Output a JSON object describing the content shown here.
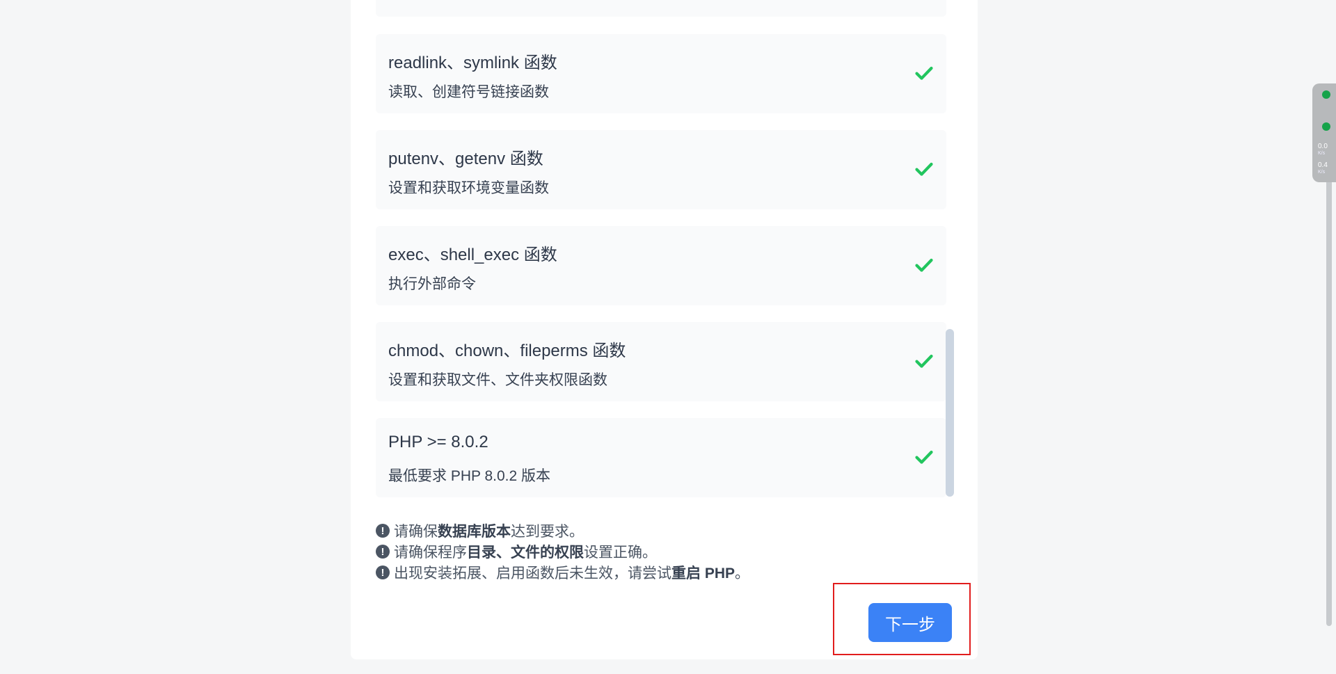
{
  "items": [
    {
      "title": "readlink、symlink 函数",
      "desc": "读取、创建符号链接函数",
      "status": "ok"
    },
    {
      "title": "putenv、getenv 函数",
      "desc": "设置和获取环境变量函数",
      "status": "ok"
    },
    {
      "title": "exec、shell_exec 函数",
      "desc": "执行外部命令",
      "status": "ok"
    },
    {
      "title": "chmod、chown、fileperms 函数",
      "desc": "设置和获取文件、文件夹权限函数",
      "status": "ok"
    },
    {
      "title": "PHP >= 8.0.2",
      "desc": "最低要求 PHP 8.0.2 版本",
      "status": "ok"
    }
  ],
  "notes": [
    {
      "pre": "请确保",
      "bold": "数据库版本",
      "post": "达到要求。"
    },
    {
      "pre": "请确保程序",
      "bold": "目录、文件的权限",
      "post": "设置正确。"
    },
    {
      "pre": "出现安装拓展、启用函数后未生效，请尝试",
      "bold": "重启 PHP",
      "post": "。"
    }
  ],
  "note_icon": "exclamation-circle-icon",
  "next_button": "下一步",
  "net_widget": {
    "upload": "0.0",
    "upload_unit": "K/s",
    "download": "0.4",
    "download_unit": "K/s"
  },
  "colors": {
    "check": "#22c55e",
    "button": "#3b82f6",
    "highlight": "#e11d1d"
  }
}
